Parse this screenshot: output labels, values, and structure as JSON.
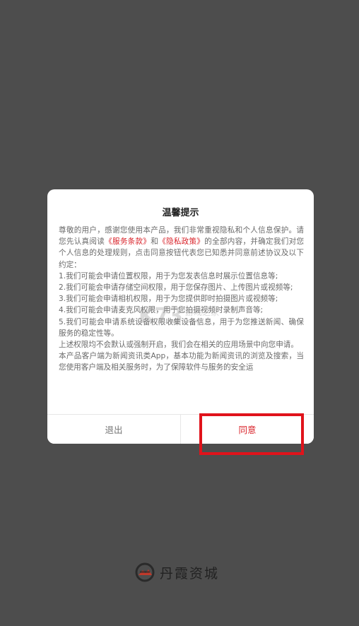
{
  "dialog": {
    "title": "温馨提示",
    "intro_a": "尊敬的用户，感谢您使用本产品，我们非常重视隐私和个人信息保护。请您先认真阅读",
    "terms_link": "《服务条款》",
    "and_text": "和",
    "privacy_link": "《隐私政策》",
    "intro_b": "的全部内容，并确定我们对您个人信息的处理规则，点击同意按钮代表您已知悉并同意前述协议及以下约定：",
    "items": [
      "1.我们可能会申请位置权限，用于为您发表信息时展示位置信息等;",
      "2.我们可能会申请存储空间权限，用于您保存图片、上传图片或视频等;",
      "3.我们可能会申请相机权限，用于为您提供即时拍摄图片或视频等;",
      "4.我们可能会申请麦克风权限，用于您拍摄视频时录制声音等;",
      "5.我们可能会申请系统设备权限收集设备信息，用于为您推送新闻、确保服务的稳定性等。"
    ],
    "para_permissions": "上述权限均不会默认或强制开启，我们会在相关的应用场景中向您申请。",
    "para_product": "本产品客户端为新闻资讯类App，基本功能为新闻资讯的浏览及搜索，当您使用客户端及相关服务时，为了保障软件与服务的安全运",
    "exit_label": "退出",
    "agree_label": "同意"
  },
  "watermark": {
    "logo": "K73",
    "cn": "游戏之家",
    "en": ".com"
  },
  "brand": {
    "name": "丹霞资城"
  },
  "colors": {
    "accent": "#d9232a",
    "highlight": "#e0131b",
    "overlay": "#4d4d4d"
  }
}
